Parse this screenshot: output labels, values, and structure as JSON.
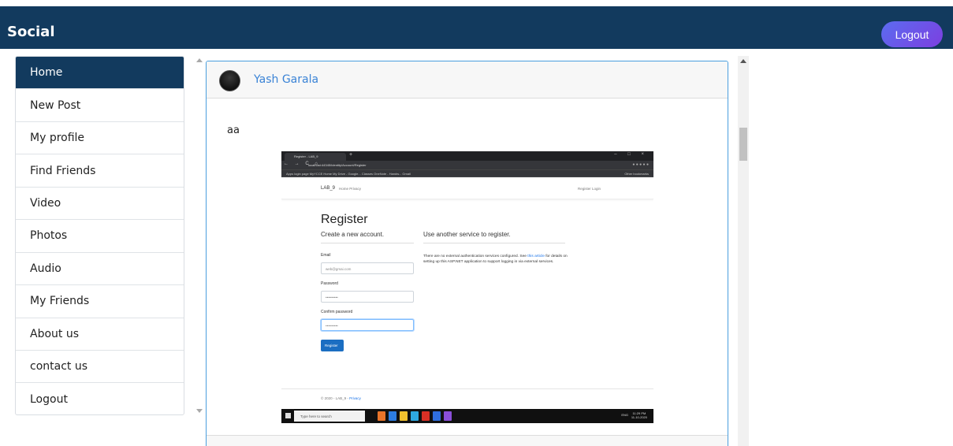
{
  "header": {
    "brand": "Social",
    "logout_label": "Logout"
  },
  "sidebar": {
    "items": [
      {
        "label": "Home",
        "active": true
      },
      {
        "label": "New Post"
      },
      {
        "label": "My profile"
      },
      {
        "label": "Find Friends"
      },
      {
        "label": "Video"
      },
      {
        "label": "Photos"
      },
      {
        "label": "Audio"
      },
      {
        "label": "My Friends"
      },
      {
        "label": "About us"
      },
      {
        "label": "contact us"
      },
      {
        "label": "Logout"
      }
    ]
  },
  "post": {
    "author": "Yash Garala",
    "text": "aa",
    "image": {
      "tab_title": "Register - LAB_9",
      "tab_plus": "+",
      "window_controls": "– □ ×",
      "nav_buttons": "← → C ⌂",
      "url": "localhost:44345/Identity/Account/Register",
      "bookmarks": "Apps   login page   MyYCCE Home   My Drive - Google...   Classes   OneNote - Handw...   Gmail",
      "other_bookmarks": "Other bookmarks",
      "site_brand": "LAB_9",
      "site_links": "Home  Privacy",
      "site_right_links": "Register  Login",
      "heading": "Register",
      "subheading_left": "Create a new account.",
      "subheading_right": "Use another service to register.",
      "email_label": "Email",
      "email_value": "web@gmai.com",
      "password_label": "Password",
      "password_value": "••••••••••",
      "confirm_label": "Confirm password",
      "confirm_value": "••••••••••",
      "info_text": "There are no external authentication services configured. See ",
      "info_link": "this article",
      "info_text2": " for details on setting up this ASP.NET application to support logging in via external services.",
      "register_button": "Register",
      "footer_text": "© 2020 - LAB_9 - ",
      "footer_link": "Privacy",
      "taskbar_search": "Type here to search",
      "taskbar_tray": "ENG",
      "taskbar_time": "11:29 PM",
      "taskbar_date": "11-10-2020"
    }
  },
  "colors": {
    "header_bg": "#123a5e",
    "active_nav_bg": "#123a5e",
    "link": "#3a83d6",
    "post_border": "#4a9ede"
  }
}
